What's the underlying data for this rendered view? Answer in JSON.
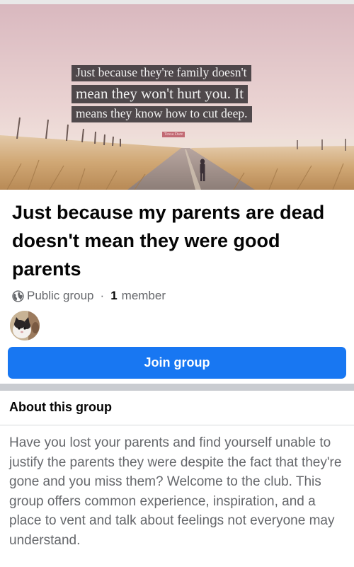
{
  "cover": {
    "quote_lines": [
      "Just because they're family doesn't",
      "mean they won't hurt you. It",
      "means they know how to cut deep."
    ],
    "quote_author": "Tessa Dare"
  },
  "group": {
    "title": "Just because my parents are dead doesn't mean they were good parents",
    "privacy": "Public group",
    "separator": "·",
    "member_count": "1",
    "member_label": "member",
    "join_label": "Join group"
  },
  "about": {
    "heading": "About this group",
    "description": "Have you lost your parents and find yourself unable to justify the parents they were despite the fact that they're gone and you miss them? Welcome to the club. This group offers common experience, inspiration, and a place to vent and talk about feelings not everyone may understand."
  },
  "colors": {
    "accent": "#1877f2",
    "secondary_text": "#65676b",
    "primary_text": "#050505"
  },
  "icons": {
    "privacy": "globe-icon"
  }
}
